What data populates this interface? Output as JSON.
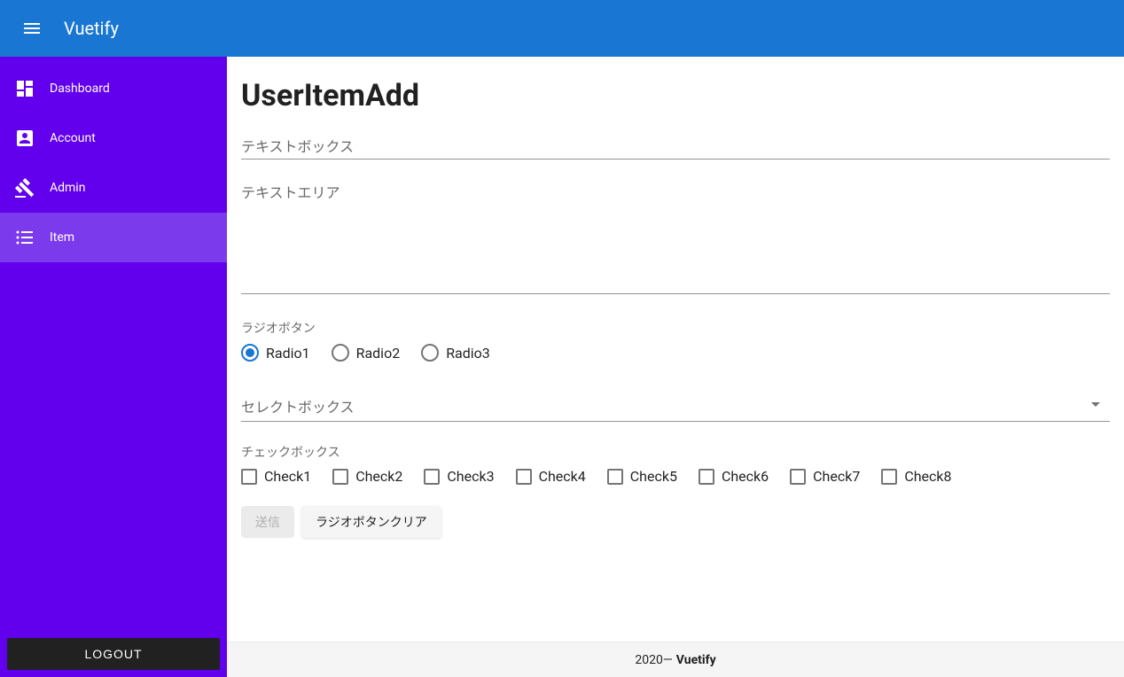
{
  "header": {
    "title": "Vuetify"
  },
  "sidebar": {
    "items": [
      {
        "label": "Dashboard",
        "icon": "dashboard",
        "active": false
      },
      {
        "label": "Account",
        "icon": "account",
        "active": false
      },
      {
        "label": "Admin",
        "icon": "gavel",
        "active": false
      },
      {
        "label": "Item",
        "icon": "list",
        "active": true
      }
    ],
    "logout_label": "LOGOUT"
  },
  "page": {
    "title": "UserItemAdd",
    "textbox_label": "テキストボックス",
    "textarea_label": "テキストエリア",
    "radio_label": "ラジオボタン",
    "radios": [
      {
        "label": "Radio1",
        "selected": true
      },
      {
        "label": "Radio2",
        "selected": false
      },
      {
        "label": "Radio3",
        "selected": false
      }
    ],
    "select_label": "セレクトボックス",
    "checkbox_label": "チェックボックス",
    "checkboxes": [
      {
        "label": "Check1"
      },
      {
        "label": "Check2"
      },
      {
        "label": "Check3"
      },
      {
        "label": "Check4"
      },
      {
        "label": "Check5"
      },
      {
        "label": "Check6"
      },
      {
        "label": "Check7"
      },
      {
        "label": "Check8"
      }
    ],
    "submit_label": "送信",
    "clear_radio_label": "ラジオボタンクリア"
  },
  "footer": {
    "year": "2020",
    "dash": " — ",
    "name": "Vuetify"
  }
}
